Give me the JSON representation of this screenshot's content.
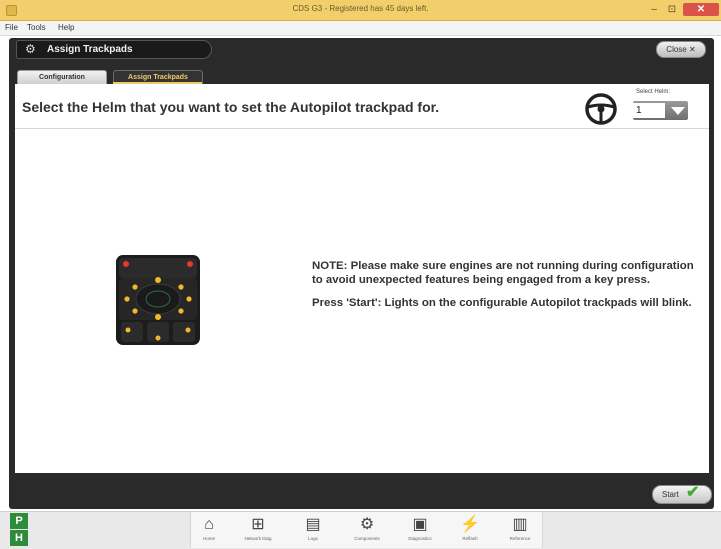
{
  "window": {
    "title": "CDS G3 - Registered has 45 days left.",
    "controls": {
      "minimize": "–",
      "maximize": "⊡",
      "close": "✕"
    }
  },
  "menu": [
    "File",
    "Tools",
    "Help"
  ],
  "header": {
    "title": "Assign Trackpads",
    "close_label": "Close"
  },
  "tabs": [
    {
      "label": "Configuration",
      "active": false
    },
    {
      "label": "Assign Trackpads",
      "active": true
    }
  ],
  "content": {
    "title": "Select the Helm that you want to set the Autopilot trackpad for.",
    "select_helm_label": "Select Helm:",
    "select_helm_value": "1",
    "note_1": "NOTE: Please make sure engines are not running during configuration to avoid unexpected features being engaged from a key press.",
    "note_2": "Press 'Start': Lights on the configurable Autopilot trackpads will blink."
  },
  "footer": {
    "start_label": "Start"
  },
  "status": {
    "p": "P",
    "h": "H"
  },
  "nav": [
    {
      "icon": "home-icon",
      "glyph": "⌂",
      "label": "Home"
    },
    {
      "icon": "network-icon",
      "glyph": "⊞",
      "label": "Network Diag"
    },
    {
      "icon": "logs-icon",
      "glyph": "▤",
      "label": "Logs"
    },
    {
      "icon": "engine-icon",
      "glyph": "⚙",
      "label": "Components"
    },
    {
      "icon": "diagnostics-icon",
      "glyph": "▣",
      "label": "Diagnostics"
    },
    {
      "icon": "reflash-icon",
      "glyph": "⚡",
      "label": "Reflash"
    },
    {
      "icon": "manual-icon",
      "glyph": "▥",
      "label": "Reference"
    }
  ],
  "colors": {
    "accent": "#f2c96a",
    "frame": "#2a2a2a",
    "status_green": "#2e8b3a",
    "titlebar": "#f2cf6b",
    "close_red": "#d9534a"
  }
}
